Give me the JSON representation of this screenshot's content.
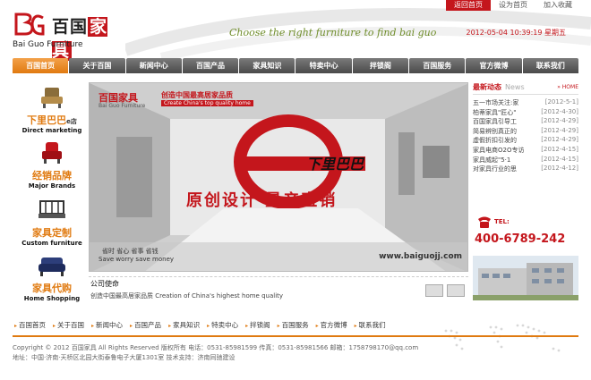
{
  "top_links": [
    {
      "label": "返回首页",
      "active": true
    },
    {
      "label": "设为首页",
      "active": false
    },
    {
      "label": "加入收藏",
      "active": false
    }
  ],
  "logo": {
    "cn_prefix": "百国",
    "cn_highlight": "家具",
    "en": "Bai Guo Furniture"
  },
  "slogan": "Choose the right furniture to find bai guo",
  "datetime": "2012-05-04 10:39:19 星期五",
  "main_nav": [
    {
      "label": "百国首页",
      "active": true
    },
    {
      "label": "关于百国",
      "active": false
    },
    {
      "label": "新闻中心",
      "active": false
    },
    {
      "label": "百国产品",
      "active": false
    },
    {
      "label": "家具知识",
      "active": false
    },
    {
      "label": "特卖中心",
      "active": false
    },
    {
      "label": "拌锁阁",
      "active": false
    },
    {
      "label": "百国服务",
      "active": false
    },
    {
      "label": "官方微博",
      "active": false
    },
    {
      "label": "联系我们",
      "active": false
    }
  ],
  "sidebar": [
    {
      "cn": "下里巴巴",
      "suffix": "e店",
      "en": "Direct marketing",
      "icon": "sofa-chair-icon"
    },
    {
      "cn": "经销品牌",
      "suffix": "",
      "en": "Major Brands",
      "icon": "armchair-icon"
    },
    {
      "cn": "家具定制",
      "suffix": "",
      "en": "Custom furniture",
      "icon": "headboard-icon"
    },
    {
      "cn": "家具代购",
      "suffix": "",
      "en": "Home Shopping",
      "icon": "sofa-icon"
    }
  ],
  "banner": {
    "logo": "百国家具",
    "logo_sub": "Bai Guo Furniture",
    "brand_cn": "创造中国最高居家品质",
    "brand_en": "Create China's top quality home",
    "e_text": "下里巴巴",
    "headline": "原创设计 量产直销",
    "tags": "省时  省心  省事  省钱",
    "tags_en": "Save worry save money",
    "url": "www.baiguojj.com"
  },
  "company": {
    "title": "公司使命",
    "desc": "创造中国最高居家品质 Creation of China's highest home quality"
  },
  "news": {
    "title": "最新动态",
    "title_en": "News",
    "more": "» HOME",
    "items": [
      {
        "title": "五一市场关注:家",
        "date": "[2012-5-1]"
      },
      {
        "title": "柏蒂家具\"匠心\"",
        "date": "[2012-4-30]"
      },
      {
        "title": "百国家具引导工",
        "date": "[2012-4-29]"
      },
      {
        "title": "简易辨别真正的",
        "date": "[2012-4-29]"
      },
      {
        "title": "虚假折扣引发的",
        "date": "[2012-4-29]"
      },
      {
        "title": "家具电商O2O专访",
        "date": "[2012-4-15]"
      },
      {
        "title": "家具威起\"5·1",
        "date": "[2012-4-15]"
      },
      {
        "title": "对家具行业的思",
        "date": "[2012-4-12]"
      }
    ]
  },
  "tel": {
    "label": "TEL:",
    "number": "400-6789-242"
  },
  "foot_nav": [
    "百国首页",
    "关于百国",
    "新闻中心",
    "百国产品",
    "家具知识",
    "特卖中心",
    "拌锁阁",
    "百国服务",
    "官方微博",
    "联系我们"
  ],
  "footer": {
    "line1": "Copyright © 2012 百国家具 All Rights Reserved 版权所有 电话：0531-85981599 传真：0531-85981566 邮箱：1758798170@qq.com",
    "line2": "地址：中国·济南·天桥区北园大街泰鲁电子大厦1301室 技术支持：济南同驰建设"
  },
  "colors": {
    "accent": "#c4161c",
    "orange": "#e07a10",
    "green": "#6f8d2a"
  }
}
